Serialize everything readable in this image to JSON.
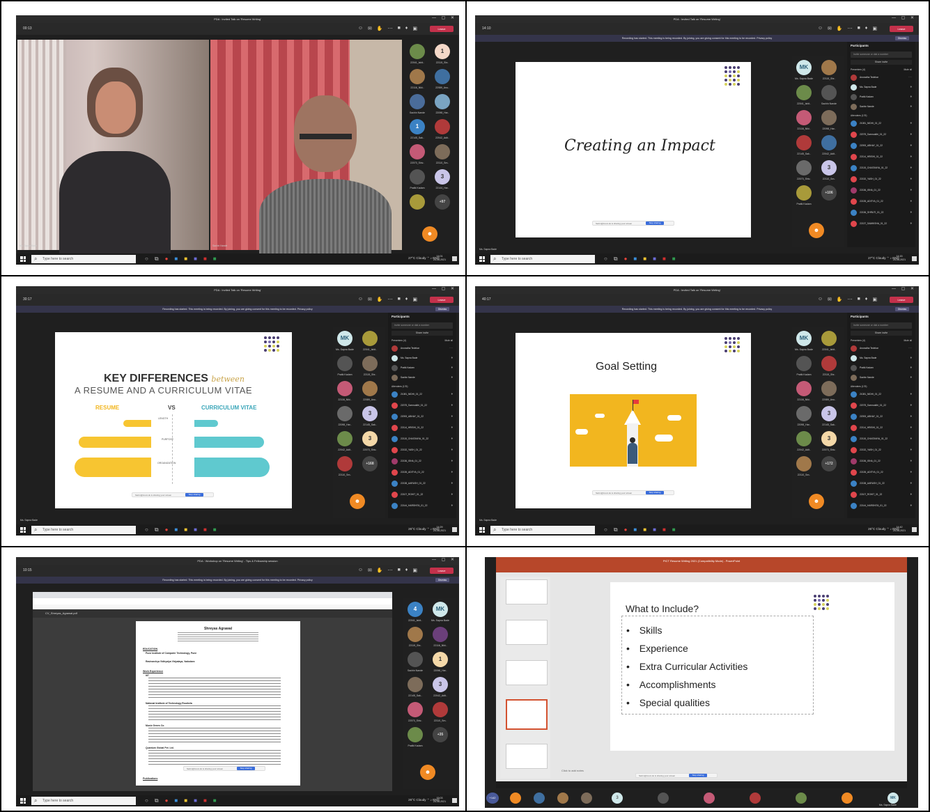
{
  "common": {
    "taskbar_search": "Type here to search",
    "weather": "27°C Cloudy",
    "weather_late": "26°C Cloudy",
    "lang": "ENG",
    "date": "25-06-2021",
    "share_stop": "Stop sharing",
    "share_msg": "Sarim@zoom.sk is sharing your screen",
    "leave": "Leave",
    "dismiss": "Dismiss",
    "banner": "Recording has started. This meeting is being recorded. By joining, you are giving consent for this meeting to be recorded. Privacy policy",
    "participants_title": "Participants",
    "invite_placeholder": "Invite someone or dial a number",
    "share_invite": "Share invite",
    "presenters": "Presenters (4)",
    "mute_all": "Mute all",
    "attendees": "Attendees (176)"
  },
  "panels": [
    {
      "title": "PDA : Invited Talk on 'Resume Writing'",
      "timer": "00:13",
      "clock": "14:01",
      "names": [
        "Ms. Sapna Bade",
        "Sachin Nande"
      ]
    },
    {
      "title": "PDA : Invited Talk on 'Resume Writing'",
      "timer": "14:10",
      "clock": "14:15",
      "slide_title": "Creating an Impact",
      "presenter": "Ms. Sapna Bade"
    },
    {
      "title": "PDA : Invited Talk on 'Resume Writing'",
      "timer": "30:17",
      "clock": "14:29",
      "heading_bold": "KEY DIFFERENCES",
      "heading_script": "between",
      "subheading": "A RESUME AND A CURRICULUM VITAE",
      "col_left": "RESUME",
      "col_mid": "VS",
      "col_right": "CURRICULUM VITAE",
      "rows": [
        "LENGTH",
        "PURPOSE",
        "ORGANIZATION"
      ],
      "presenter": "Ms. Sapna Bade"
    },
    {
      "title": "PDA : Invited Talk on 'Resume Writing'",
      "timer": "40:17",
      "clock": "14:42",
      "slide_title": "Goal Setting",
      "presenter": "Ms. Sapna Bade"
    },
    {
      "title": "PDA : Workshop on 'Resume Writing' - Tips & Fellowship session",
      "timer": "10:15",
      "clock": "15:03",
      "doc_file": "CV_Shreyas_Agrawal.pdf",
      "cv_name": "Shreyas Agrawal",
      "cv_sections": [
        "EDUCATION",
        "Work Experience",
        "Publications"
      ],
      "cv_orgs": [
        "Pune Institute of Computer Technology, Pune",
        "Ravivarchya Vidhyalya Vidyalaya, Vadodara",
        "IIIT",
        "National Institute of Technology Rourkela",
        "Music Genes Co.",
        "Quantum Global Pvt. Ltd."
      ]
    },
    {
      "title": "PICT Resume Writing 2021 (Compatibility Mode) - PowerPoint",
      "slide_title": "What to Include?",
      "bullets": [
        "Skills",
        "Experience",
        "Extra Curricular Activities",
        "Accomplishments",
        "Special qualities"
      ],
      "notes": "Click to add notes",
      "bottom_names": [
        "Ms. Sapna Bade"
      ]
    }
  ],
  "tile_labels": [
    "22041_Ishit..",
    "22115_Shr..",
    "22116_Niki..",
    "22089_Anu..",
    "Sachin Nande",
    "22098_Har..",
    "22145_Sak..",
    "22042_Adit..",
    "22070_Shiv..",
    "22110_Sm..",
    "Pratik Kadam",
    "22144_Har.."
  ],
  "attendee_names": [
    "Anuradha Tedekar",
    "Ms. Sapna Bade",
    "Pratik Kadam",
    "Sachin Nande",
    "21081_NIDHI_01_22",
    "22075_Samruddhi_01_22",
    "22093_ABHAY_01_22",
    "22114_HRISHI_01_22",
    "22115_CHAITANYA_01_22",
    "22132_YASH_01_22",
    "22136_ISHA_01_22",
    "22135_ADITYA_01_22",
    "22136_SHRUTI_01_22",
    "22137_SAMIKSHA_01_22",
    "22138_AARUSH_01_22",
    "22107_ROHIT_01_22",
    "22144_HARSHITA_01_22"
  ],
  "colors": {
    "teams_dark": "#1f1f1f",
    "leave_red": "#c4314b",
    "accent_blue": "#3a6ddb",
    "slide_yellow": "#f7c531",
    "slide_teal": "#5fc9cf",
    "goal_bg": "#f2b61f",
    "accent_purple": "#4b3f72"
  }
}
